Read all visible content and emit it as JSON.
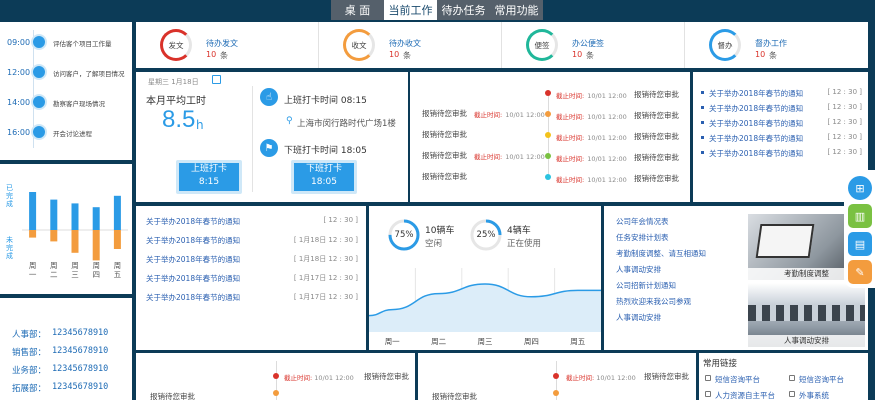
{
  "topnav": {
    "tabs": [
      {
        "label": "桌 面"
      },
      {
        "label": "当前工作"
      },
      {
        "label": "待办任务"
      },
      {
        "label": "常用功能"
      }
    ]
  },
  "schedule": [
    {
      "time": "09:00",
      "text": "评估客个项目工作量"
    },
    {
      "time": "12:00",
      "text": "访问客户，了解项目情况"
    },
    {
      "time": "14:00",
      "text": "勘察客户现场情况"
    },
    {
      "time": "16:00",
      "text": "开会讨论进程"
    }
  ],
  "bar_chart": {
    "chart_data": {
      "type": "bar",
      "categories": [
        "周一",
        "周二",
        "周三",
        "周四",
        "周五"
      ],
      "series": [
        {
          "name": "已完成",
          "values": [
            1.0,
            0.8,
            0.7,
            0.6,
            0.9
          ]
        },
        {
          "name": "未完成",
          "values": [
            -0.2,
            -0.3,
            -0.6,
            -0.8,
            -0.5
          ]
        }
      ],
      "ylim": [
        -1,
        1
      ],
      "colors": [
        "#2b9be6",
        "#f39c3e"
      ]
    },
    "y_upper": "已完成",
    "y_lower": "未完成"
  },
  "dept_phones": [
    {
      "dept": "人事部：",
      "phone": "12345678910"
    },
    {
      "dept": "销售部：",
      "phone": "12345678910"
    },
    {
      "dept": "业务部：",
      "phone": "12345678910"
    },
    {
      "dept": "拓展部：",
      "phone": "12345678910"
    }
  ],
  "stats": [
    {
      "icon": "发文",
      "title": "待办发文",
      "count": "10",
      "unit": "条",
      "color": "#d9322a"
    },
    {
      "icon": "收文",
      "title": "待办收文",
      "count": "10",
      "unit": "条",
      "color": "#f39c3e"
    },
    {
      "icon": "便签",
      "title": "办公便签",
      "count": "10",
      "unit": "条",
      "color": "#20b79a"
    },
    {
      "icon": "督办",
      "title": "督办工作",
      "count": "10",
      "unit": "条",
      "color": "#2b9be6"
    }
  ],
  "attendance": {
    "date": "星期三 1月18日",
    "avg_label": "本月平均工时",
    "avg_value": "8.5",
    "avg_unit": "h",
    "checkin_label": "上班打卡时间 08:15",
    "location": "上海市闵行路时代广场1楼",
    "checkout_label": "下班打卡时间 18:05",
    "btn_in": {
      "title": "上班打卡",
      "time": "8:15"
    },
    "btn_out": {
      "title": "下班打卡",
      "time": "18:05"
    }
  },
  "approvals_top": {
    "left_items": [
      "报销待您审批",
      "报销待您审批",
      "报销待您审批",
      "报销待您审批"
    ],
    "deadline_label": "截止时间:",
    "deadline_date": "10/01 12:00",
    "timeline": [
      {
        "color": "#d9322a",
        "deadline": "截止时间:",
        "date": "10/01 12:00",
        "text": "报销待您审批"
      },
      {
        "color": "#f39c3e",
        "deadline": "截止时间:",
        "date": "10/01 12:00",
        "text": "报销待您审批"
      },
      {
        "color": "#f3c21b",
        "deadline": "截止时间:",
        "date": "10/01 12:00",
        "text": "报销待您审批"
      },
      {
        "color": "#7ac142",
        "deadline": "截止时间:",
        "date": "10/01 12:00",
        "text": "报销待您审批"
      },
      {
        "color": "#2bc3e0",
        "deadline": "截止时间:",
        "date": "10/01 12:00",
        "text": "报销待您审批"
      }
    ]
  },
  "notices_right": [
    {
      "title": "关于举办2018年春节的通知",
      "time": "[ 12 : 30 ]"
    },
    {
      "title": "关于举办2018年春节的通知",
      "time": "[ 12 : 30 ]"
    },
    {
      "title": "关于举办2018年春节的通知",
      "time": "[ 12 : 30 ]"
    },
    {
      "title": "关于举办2018年春节的通知",
      "time": "[ 12 : 30 ]"
    },
    {
      "title": "关于举办2018年春节的通知",
      "time": "[ 12 : 30 ]"
    }
  ],
  "notices_mid": [
    {
      "title": "关于举办2018年春节的通知",
      "time": "[ 12 : 30 ]"
    },
    {
      "title": "关于举办2018年春节的通知",
      "time": "[ 1月18日 12 : 30 ]"
    },
    {
      "title": "关于举办2018年春节的通知",
      "time": "[ 1月18日 12 : 30 ]"
    },
    {
      "title": "关于举办2018年春节的通知",
      "time": "[ 1月17日 12 : 30 ]"
    },
    {
      "title": "关于举办2018年春节的通知",
      "time": "[ 1月17日 12 : 30 ]"
    }
  ],
  "vehicles": {
    "gauges": [
      {
        "percent": "75%",
        "value": 0.75,
        "count": "10辆车",
        "label": "空闲"
      },
      {
        "percent": "25%",
        "value": 0.25,
        "count": "4辆车",
        "label": "正在使用"
      }
    ],
    "chart_data": {
      "type": "area",
      "categories": [
        "周一",
        "周二",
        "周三",
        "周四",
        "周五"
      ],
      "values": [
        0.35,
        0.6,
        0.75,
        0.55,
        0.65
      ],
      "ylim": [
        0,
        1
      ]
    }
  },
  "news": {
    "links": [
      "公司年会情况表",
      "任务安排计划表",
      "考勤制度调整、请互相通知",
      "人事调动安排",
      "公司招新计划通知",
      "热烈欢迎来我公司参观",
      "人事调动安排"
    ],
    "thumbs": [
      {
        "caption": "考勤制度调整"
      },
      {
        "caption": "人事调动安排"
      }
    ]
  },
  "approvals_bottom": {
    "item": "报销待您审批",
    "deadline": "截止时间:",
    "date": "10/01 12:00"
  },
  "quick_links": {
    "title": "常用链接",
    "items": [
      "短信咨询平台",
      "短信咨询平台",
      "人力资源自主平台",
      "外事系统"
    ]
  },
  "side_toolbar": [
    {
      "icon": "apps-icon",
      "color": "#2b9be6"
    },
    {
      "icon": "trash-icon",
      "color": "#7ac142"
    },
    {
      "icon": "document-icon",
      "color": "#2b9be6"
    },
    {
      "icon": "note-icon",
      "color": "#f39c3e"
    }
  ]
}
